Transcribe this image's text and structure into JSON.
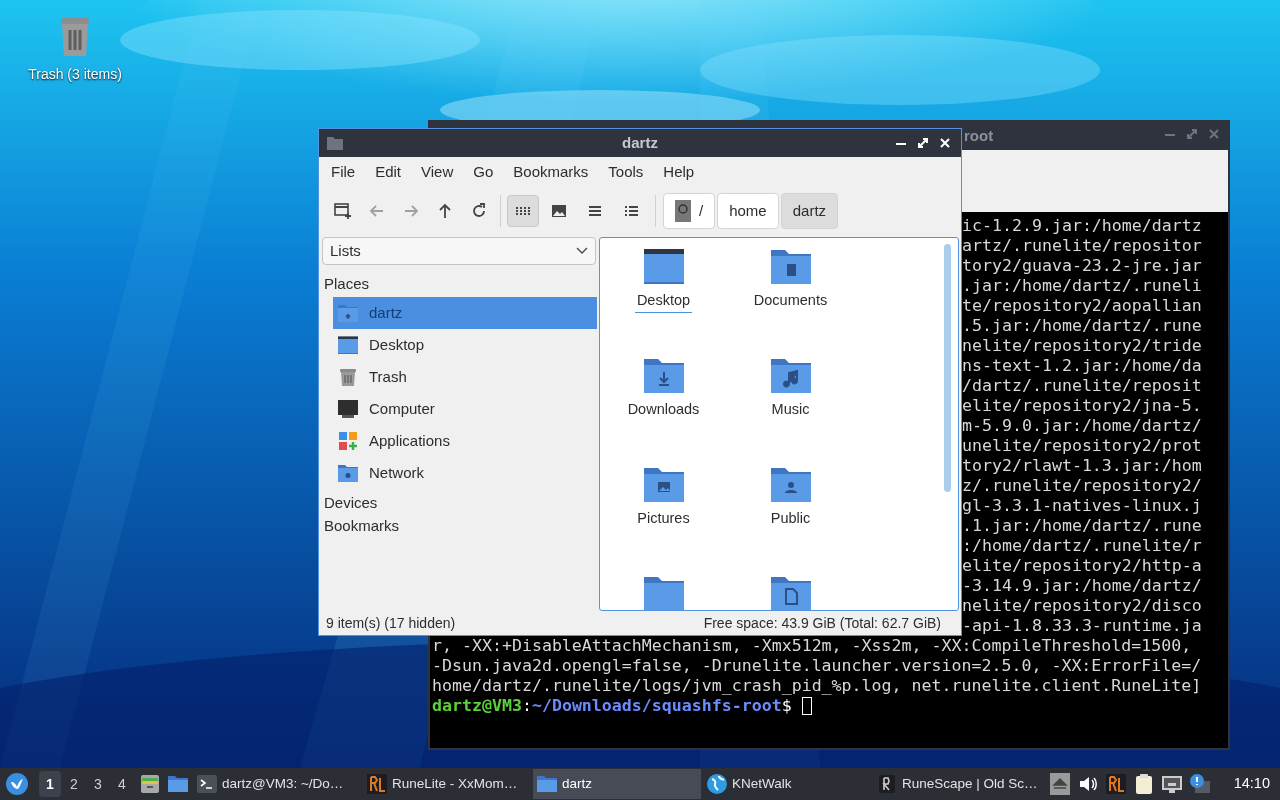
{
  "desktop": {
    "icons": [
      {
        "kind": "trash",
        "label": "Trash (3 items)"
      }
    ]
  },
  "terminal_window": {
    "title": "root",
    "lines": [
      "ic-1.2.9.jar:/home/dartz",
      "artz/.runelite/repositor",
      "tory2/guava-23.2-jre.jar",
      ".jar:/home/dartz/.runeli",
      "te/repository2/aopallian",
      ".5.jar:/home/dartz/.rune",
      "nelite/repository2/tride",
      "ns-text-1.2.jar:/home/da",
      "/dartz/.runelite/reposit",
      "elite/repository2/jna-5.",
      "m-5.9.0.jar:/home/dartz/",
      "unelite/repository2/prot",
      "tory2/rlawt-1.3.jar:/hom",
      "z/.runelite/repository2/",
      "gl-3.3.1-natives-linux.j",
      ".1.jar:/home/dartz/.rune",
      ":/home/dartz/.runelite/r",
      "elite/repository2/http-a",
      "-3.14.9.jar:/home/dartz/",
      "nelite/repository2/disco",
      "-api-1.8.33.3-runtime.ja"
    ],
    "full_lines": [
      "r, -XX:+DisableAttachMechanism, -Xmx512m, -Xss2m, -XX:CompileThreshold=1500,",
      "-Dsun.java2d.opengl=false, -Drunelite.launcher.version=2.5.0, -XX:ErrorFile=/",
      "home/dartz/.runelite/logs/jvm_crash_pid_%p.log, net.runelite.client.RuneLite]"
    ],
    "prompt": {
      "user": "dartz@VM3",
      "separator": ":",
      "path": "~/Downloads/squashfs-root",
      "symbol": "$"
    }
  },
  "file_manager": {
    "title": "dartz",
    "menu": [
      "File",
      "Edit",
      "View",
      "Go",
      "Bookmarks",
      "Tools",
      "Help"
    ],
    "nav_buttons": [
      {
        "kind": "new-tab",
        "disabled": false
      },
      {
        "kind": "back",
        "disabled": true
      },
      {
        "kind": "forward",
        "disabled": true
      },
      {
        "kind": "up",
        "disabled": false
      },
      {
        "kind": "reload",
        "disabled": false
      }
    ],
    "view_modes": [
      {
        "kind": "icons",
        "selected": true
      },
      {
        "kind": "thumbnails",
        "selected": false
      },
      {
        "kind": "compact",
        "selected": false
      },
      {
        "kind": "list",
        "selected": false
      }
    ],
    "path_bar": [
      {
        "label": "/",
        "kind": "root",
        "selected": false
      },
      {
        "label": "home",
        "kind": "dir",
        "selected": false
      },
      {
        "label": "dartz",
        "kind": "dir",
        "selected": true
      }
    ],
    "sidebar": {
      "dropdown": "Lists",
      "sections": [
        {
          "label": "Places",
          "items": [
            {
              "kind": "home",
              "label": "dartz",
              "selected": true
            },
            {
              "kind": "desktop",
              "label": "Desktop",
              "selected": false
            },
            {
              "kind": "trash",
              "label": "Trash",
              "selected": false
            },
            {
              "kind": "computer",
              "label": "Computer",
              "selected": false
            },
            {
              "kind": "applications",
              "label": "Applications",
              "selected": false
            },
            {
              "kind": "network",
              "label": "Network",
              "selected": false
            }
          ]
        },
        {
          "label": "Devices"
        },
        {
          "label": "Bookmarks"
        }
      ]
    },
    "folders": [
      {
        "kind": "desktop",
        "label": "Desktop",
        "focused": true
      },
      {
        "kind": "documents",
        "label": "Documents",
        "focused": false
      },
      {
        "kind": "downloads",
        "label": "Downloads",
        "focused": false
      },
      {
        "kind": "music",
        "label": "Music",
        "focused": false
      },
      {
        "kind": "pictures",
        "label": "Pictures",
        "focused": false
      },
      {
        "kind": "public",
        "label": "Public",
        "focused": false
      },
      {
        "kind": "plain"
      },
      {
        "kind": "templates"
      }
    ],
    "status": {
      "items": "9 item(s) (17 hidden)",
      "free_space": "Free space: 43.9 GiB (Total: 62.7 GiB)"
    }
  },
  "taskbar": {
    "workspaces": [
      {
        "label": "1",
        "selected": true
      },
      {
        "label": "2",
        "selected": false
      },
      {
        "label": "3",
        "selected": false
      },
      {
        "label": "4",
        "selected": false
      }
    ],
    "launchers": [
      {
        "kind": "cabinet"
      },
      {
        "kind": "folder"
      }
    ],
    "tasks": [
      {
        "kind": "terminal",
        "label": "dartz@VM3: ~/Do…",
        "selected": false
      },
      {
        "kind": "runelite",
        "label": "RuneLite - XxMom…",
        "selected": false
      },
      {
        "kind": "folder",
        "label": "dartz",
        "selected": true
      },
      {
        "kind": "globe",
        "label": "KNetWalk",
        "selected": false
      },
      {
        "kind": "runescape",
        "label": "RuneScape | Old Sc…",
        "selected": false
      }
    ],
    "tray": [
      {
        "kind": "eject"
      },
      {
        "kind": "volume"
      },
      {
        "kind": "runelite"
      },
      {
        "kind": "clipboard"
      },
      {
        "kind": "network"
      },
      {
        "kind": "notification"
      }
    ],
    "clock": "14:10"
  }
}
